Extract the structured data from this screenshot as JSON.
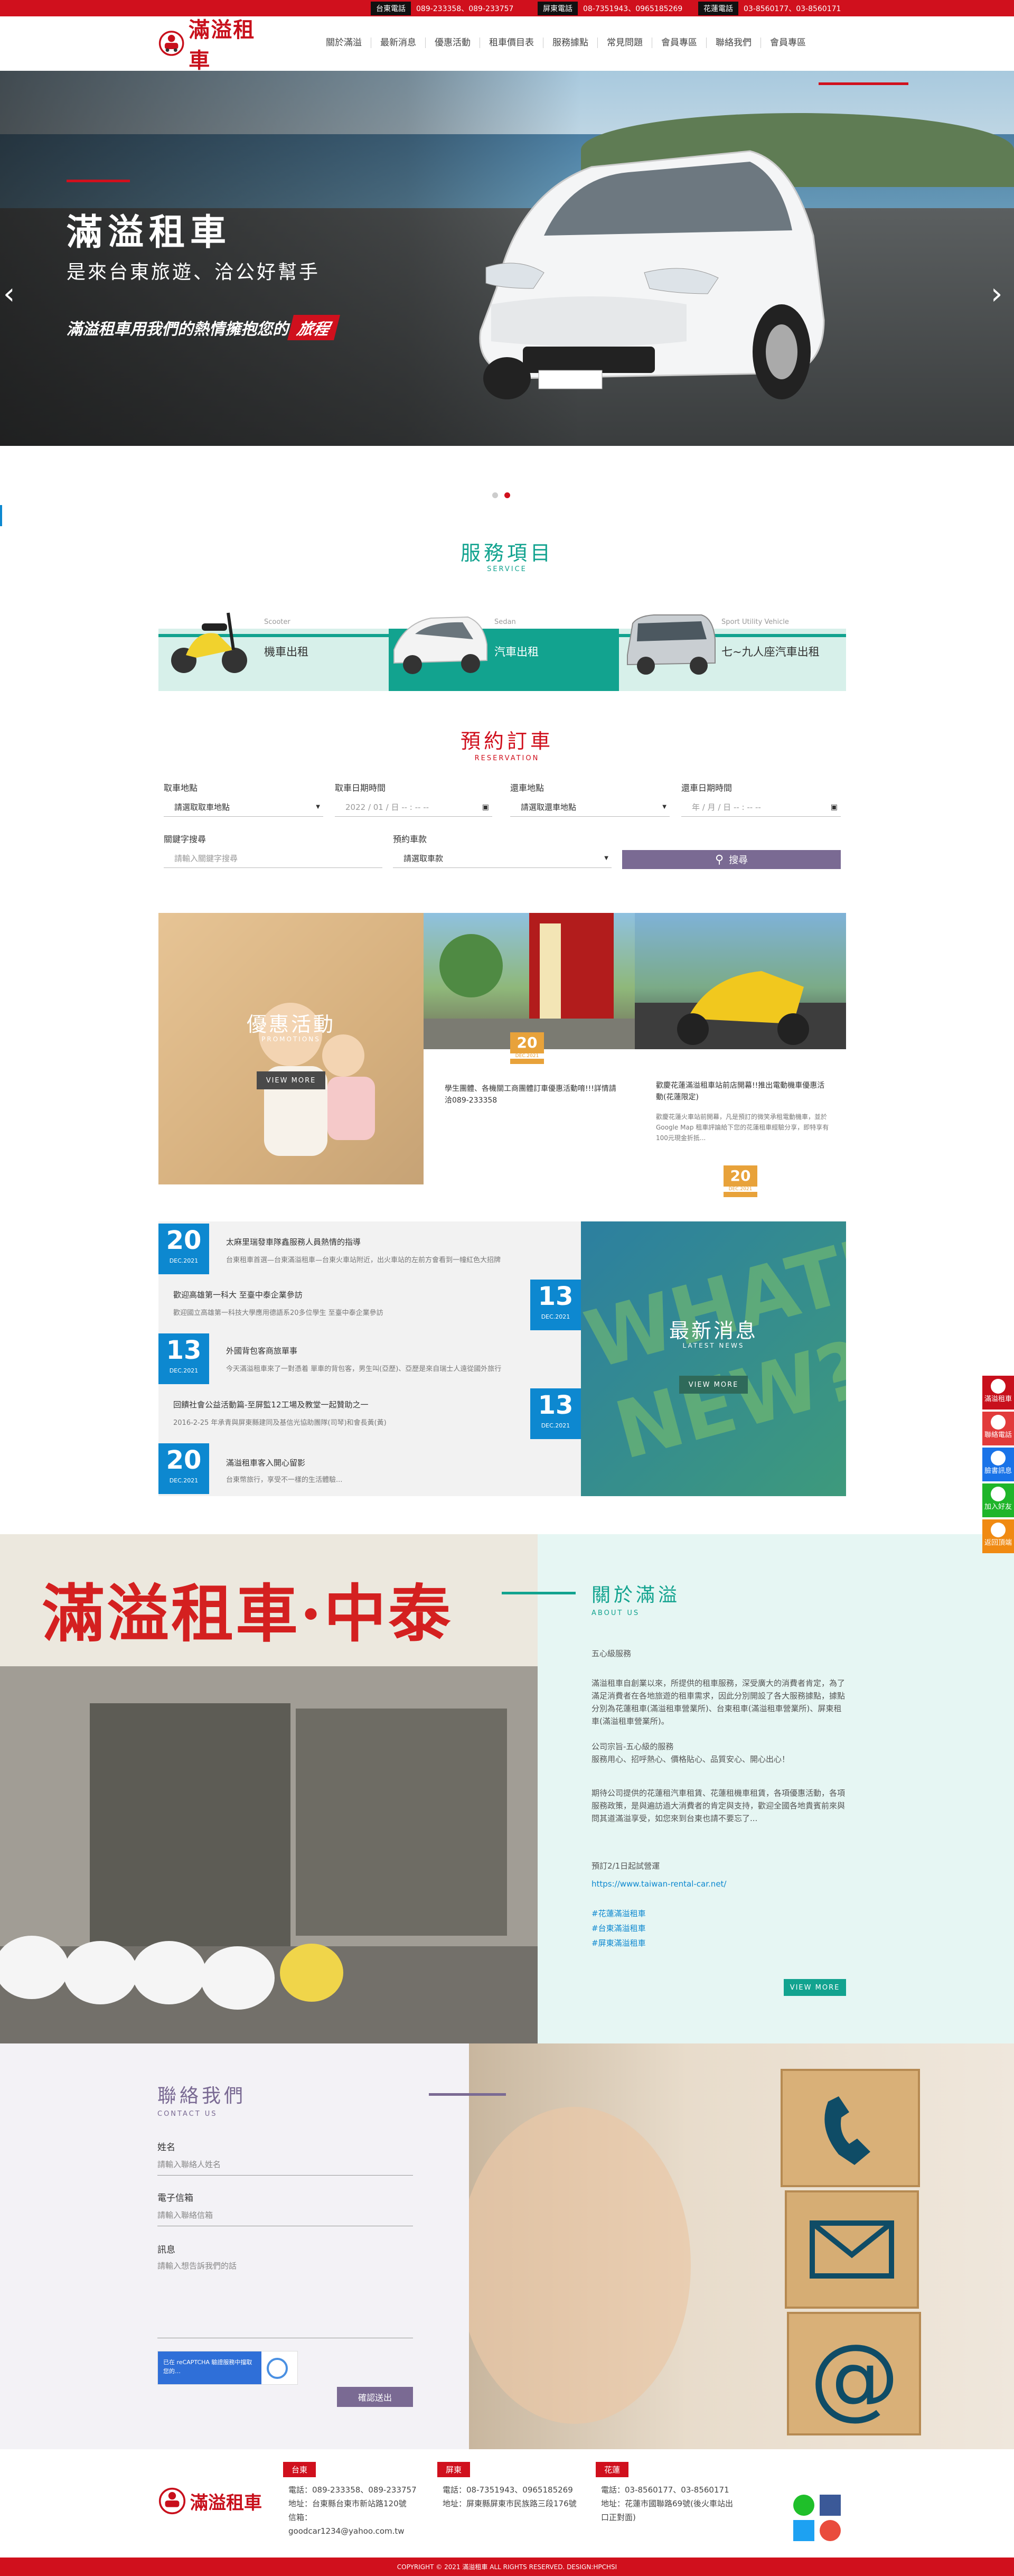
{
  "topbar": {
    "items": [
      {
        "tag": "台東電話",
        "text": "089-233358、089-233757"
      },
      {
        "tag": "屏東電話",
        "text": "08-7351943、0965185269"
      },
      {
        "tag": "花蓮電話",
        "text": "03-8560177、03-8560171"
      }
    ]
  },
  "header": {
    "logo_text": "滿溢租車",
    "nav": [
      "關於滿溢",
      "最新消息",
      "優惠活動",
      "租車價目表",
      "服務據點",
      "常見問題",
      "會員專區",
      "聯絡我們",
      "會員專區"
    ]
  },
  "hero": {
    "title": "滿溢租車",
    "subtitle": "是來台東旅遊、洽公好幫手",
    "slogan_a": "滿溢租車用我們的熱情擁抱您的",
    "slogan_b": "旅程",
    "prev_glyph": "‹",
    "next_glyph": "›"
  },
  "services": {
    "title": "服務項目",
    "subtitle": "SERVICE",
    "items": [
      {
        "en": "Scooter",
        "label": "機車出租"
      },
      {
        "en": "Sedan",
        "label": "汽車出租"
      },
      {
        "en": "Sport Utility Vehicle",
        "label": "七~九人座汽車出租"
      }
    ]
  },
  "reservation": {
    "title": "預約訂車",
    "subtitle": "RESERVATION",
    "pickup_place_label": "取車地點",
    "pickup_place_value": "請選取取車地點",
    "pickup_date_label": "取車日期時間",
    "pickup_date_value": "2022 / 01 / 日  -- : -- --",
    "return_place_label": "還車地點",
    "return_place_value": "請選取還車地點",
    "return_date_label": "還車日期時間",
    "return_date_value": "年 / 月 / 日  -- : -- --",
    "keyword_label": "關鍵字搜尋",
    "keyword_placeholder": "請輸入關鍵字搜尋",
    "vehicle_label": "預約車款",
    "vehicle_value": "請選取車款",
    "search_label": "搜尋"
  },
  "promotions": {
    "title": "優惠活動",
    "subtitle": "PROMOTIONS",
    "view_more": "VIEW MORE",
    "cards": [
      {
        "day": "20",
        "mon": "DEC.2021",
        "title": "學生團體、各機關工商團體訂車優惠活動唷!!!詳情請洽089-233358",
        "desc": ""
      },
      {
        "day": "20",
        "mon": "DEC.2021",
        "title": "歡慶花蓮滿溢租車站前店開幕!!推出電動機車優惠活動(花蓮限定)",
        "desc": "歡慶花蓮火車站前開幕，凡是預訂的微笑承租電動機車，並於Google Map 租車評論給下您的花蓮租車經驗分享，即特享有100元現金折抵..."
      }
    ]
  },
  "news": {
    "title": "最新消息",
    "subtitle": "LATEST NEWS",
    "view_more": "VIEW MORE",
    "items": [
      {
        "day": "20",
        "mon": "DEC.2021",
        "title": "太麻里瑞發車隊鑫服務人員熱情的指導",
        "desc": "台東租車首選—台東滿溢租車—台東火車站附近，出火車站的左前方會看到一幢紅色大招牌"
      },
      {
        "day": "13",
        "mon": "DEC.2021",
        "title": "歡迎高雄第一科大 至臺中泰企業參訪",
        "desc": "歡迎國立高雄第一科技大學應用德語系20多位學生 至臺中泰企業參訪"
      },
      {
        "day": "13",
        "mon": "DEC.2021",
        "title": "外國背包客商旅單事",
        "desc": "今天滿溢租車來了一對憑着 單車的背包客，男生叫(亞歷)、亞歷是來自瑞士人遠從國外旅行"
      },
      {
        "day": "13",
        "mon": "DEC.2021",
        "title": "回饋社會公益活動篇-至屏監12工場及教堂一起贊助之一",
        "desc": "2016-2-25 年承青與屏東縣建同及基信光協助團隊(司琴)和會長黃(黃)"
      },
      {
        "day": "20",
        "mon": "DEC.2021",
        "title": "滿溢租車客入開心留影",
        "desc": "台東幣旅行，享受不一樣的生活體驗..."
      }
    ]
  },
  "about": {
    "title": "關於滿溢",
    "subtitle": "ABOUT US",
    "p1": "五心級服務",
    "p2": "滿溢租車自創業以來，所提供的租車服務，深受廣大的消費者肯定，為了滿足消費者在各地旅遊的租車需求，因此分別開設了各大服務據點，據點分別為花蓮租車(滿溢租車營業所)、台東租車(滿溢租車營業所)、屏東租車(滿溢租車營業所)。",
    "p3": "公司宗旨-五心級的服務",
    "p4": "服務用心、招呼熱心、價格貼心、品質安心、開心出心！",
    "p5": "期待公司提供的花蓮租汽車租賃、花蓮租機車租賃，各項優惠活動，各項服務政策，是與遍訪過大消費者的肯定與支持，歡迎全國各地貴賓前來與問其道滿溢享受，如您來到台東也請不要忘了...",
    "p6": "預訂2/1日起試營運",
    "link": "https://www.taiwan-rental-car.net/",
    "tags": [
      "#花蓮滿溢租車",
      "#台東滿溢租車",
      "#屏東滿溢租車"
    ],
    "view_more": "VIEW MORE",
    "sign_text": "滿溢租車·中泰"
  },
  "contact": {
    "title": "聯絡我們",
    "subtitle": "CONTACT US",
    "name_label": "姓名",
    "name_placeholder": "請輸入聯絡人姓名",
    "email_label": "電子信箱",
    "email_placeholder": "請輸入聯絡信箱",
    "msg_label": "訊息",
    "msg_placeholder": "請輸入想告訴我們的話",
    "recaptcha": "已在 reCAPTCHA 驗證服務中擋取您的…",
    "submit": "確認送出"
  },
  "footer": {
    "logo_text": "滿溢租車",
    "branches": [
      {
        "tag": "台東",
        "phone": "電話：089-233358、089-233757",
        "addr": "地址：台東縣台東市新站路120號",
        "mail": "信箱：",
        "mail2": "goodcar1234@yahoo.com.tw"
      },
      {
        "tag": "屏東",
        "phone": "電話：08-7351943、0965185269",
        "addr": "地址：屏東縣屏東市民族路三段176號",
        "mail": "",
        "mail2": ""
      },
      {
        "tag": "花蓮",
        "phone": "電話：03-8560177、03-8560171",
        "addr": "地址：花蓮市國聯路69號(後火車站出口正對面)",
        "mail": "",
        "mail2": ""
      }
    ],
    "copyright": "COPYRIGHT © 2021 滿溢租車 ALL RIGHTS RESERVED.    DESIGN:HPCHSI"
  },
  "side": [
    "滿溢租車",
    "聯絡電話",
    "臉書訊息",
    "加入好友",
    "返回頂端"
  ],
  "colors": {
    "brand_red": "#d0101d",
    "teal": "#12a38f",
    "blue": "#0d88d0",
    "purple": "#7a6a93"
  }
}
